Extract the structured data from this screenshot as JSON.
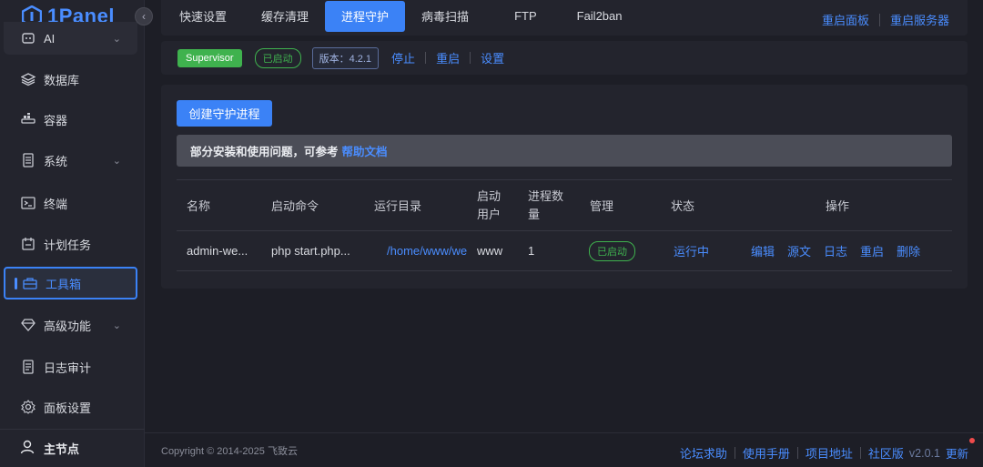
{
  "app": {
    "brand": "1Panel"
  },
  "sidebar": {
    "items": [
      {
        "label": "AI",
        "icon": "ai-icon",
        "chevron": true
      },
      {
        "label": "数据库",
        "icon": "database-icon"
      },
      {
        "label": "容器",
        "icon": "container-icon"
      },
      {
        "label": "系统",
        "icon": "system-icon",
        "chevron": true
      },
      {
        "label": "终端",
        "icon": "terminal-icon"
      },
      {
        "label": "计划任务",
        "icon": "calendar-icon"
      },
      {
        "label": "工具箱",
        "icon": "toolbox-icon",
        "active": true
      },
      {
        "label": "高级功能",
        "icon": "diamond-icon",
        "chevron": true
      },
      {
        "label": "日志审计",
        "icon": "log-icon"
      },
      {
        "label": "面板设置",
        "icon": "settings-icon"
      }
    ],
    "footer": {
      "label": "主节点",
      "icon": "user-icon"
    }
  },
  "tabs": {
    "items": [
      {
        "label": "快速设置"
      },
      {
        "label": "缓存清理"
      },
      {
        "label": "进程守护",
        "active": true
      },
      {
        "label": "病毒扫描"
      },
      {
        "label": "FTP"
      },
      {
        "label": "Fail2ban"
      }
    ],
    "restart_panel": "重启面板",
    "restart_server": "重启服务器"
  },
  "status": {
    "name": "Supervisor",
    "state": "已启动",
    "version": "版本：4.2.1",
    "stop": "停止",
    "restart": "重启",
    "settings": "设置"
  },
  "main": {
    "create_button": "创建守护进程",
    "alert_text": "部分安装和使用问题，可参考",
    "alert_link": "帮助文档",
    "columns": {
      "name": "名称",
      "command": "启动命令",
      "dir": "运行目录",
      "user": "启动用户",
      "count": "进程数量",
      "manage": "管理",
      "status": "状态",
      "ops": "操作"
    },
    "rows": [
      {
        "name": "admin-we...",
        "command": "php start.php...",
        "dir": "/home/www/we",
        "user": "www",
        "count": "1",
        "manage": "已启动",
        "status": "运行中",
        "ops": {
          "edit": "编辑",
          "source": "源文",
          "log": "日志",
          "restart": "重启",
          "delete": "删除"
        }
      }
    ]
  },
  "footer": {
    "copyright": "Copyright © 2014-2025 飞致云",
    "forum": "论坛求助",
    "manual": "使用手册",
    "project": "项目地址",
    "edition": "社区版",
    "version": "v2.0.1",
    "update": "更新"
  },
  "colors": {
    "accent": "#3b82f6",
    "success": "#3fb24e",
    "bg": "#1d1e26",
    "panel": "#23242d"
  }
}
